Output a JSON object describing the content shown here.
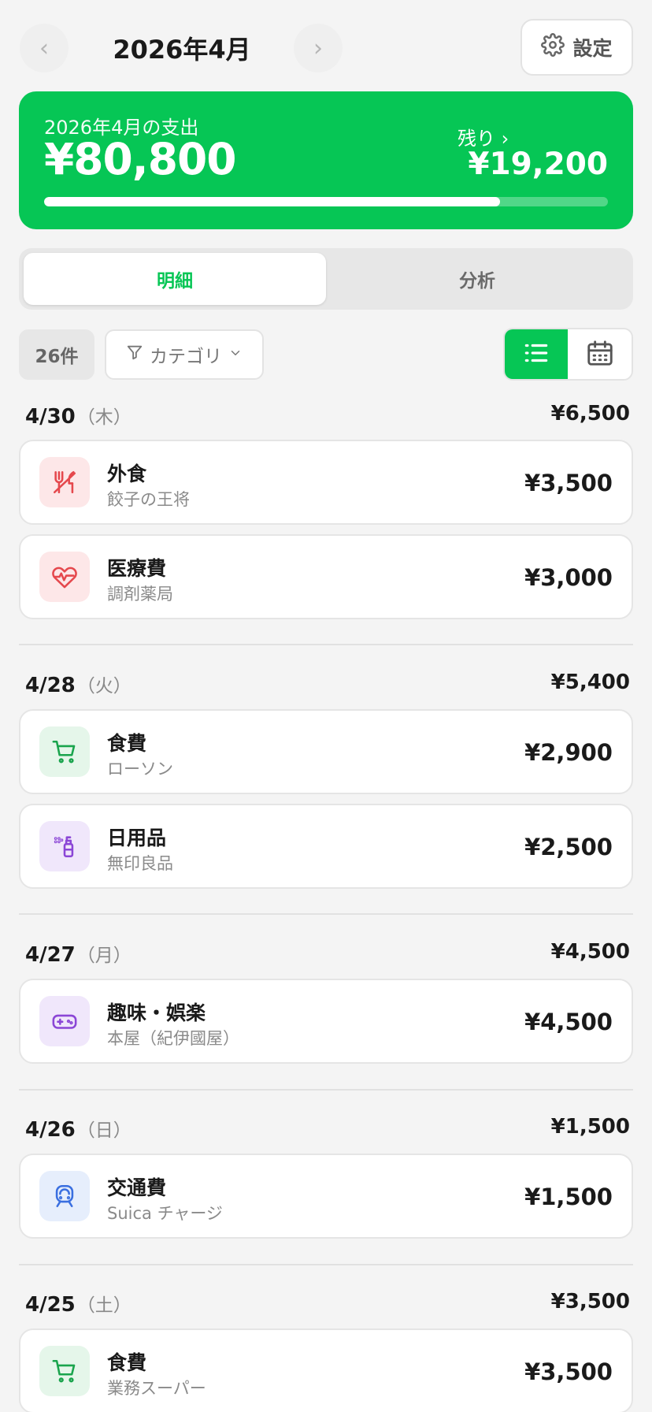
{
  "header": {
    "prev_label": "‹",
    "next_label": "›",
    "month": "2026年4月",
    "settings_label": "設定"
  },
  "summary": {
    "label": "2026年4月の支出",
    "total": "¥80,800",
    "remaining_label": "残り ›",
    "remaining": "¥19,200",
    "progress_ratio": 0.808
  },
  "tabs": [
    {
      "label": "明細",
      "active": true
    },
    {
      "label": "分析",
      "active": false
    }
  ],
  "filters": {
    "count": "26件",
    "category_label": "カテゴリ"
  },
  "colors": {
    "accent": "#06c655",
    "dining_bg": "#fde7e8",
    "dining_fg": "#e5484d",
    "medical_bg": "#fde7e8",
    "medical_fg": "#e5484d",
    "food_bg": "#e5f6ea",
    "food_fg": "#1aa44d",
    "daily_bg": "#f0e7fb",
    "daily_fg": "#8b46d6",
    "hobby_bg": "#f0e7fb",
    "hobby_fg": "#8b46d6",
    "transport_bg": "#e6eefc",
    "transport_fg": "#3a6fe0"
  },
  "days": [
    {
      "date": "4/30",
      "weekday": "（木）",
      "total": "¥6,500",
      "items": [
        {
          "icon": "fork-knife-icon",
          "category": "外食",
          "store": "餃子の王将",
          "amount": "¥3,500"
        },
        {
          "icon": "heart-pulse-icon",
          "category": "医療費",
          "store": "調剤薬局",
          "amount": "¥3,000"
        }
      ]
    },
    {
      "date": "4/28",
      "weekday": "（火）",
      "total": "¥5,400",
      "items": [
        {
          "icon": "cart-icon",
          "category": "食費",
          "store": "ローソン",
          "amount": "¥2,900"
        },
        {
          "icon": "spray-bottle-icon",
          "category": "日用品",
          "store": "無印良品",
          "amount": "¥2,500"
        }
      ]
    },
    {
      "date": "4/27",
      "weekday": "（月）",
      "total": "¥4,500",
      "items": [
        {
          "icon": "gamepad-icon",
          "category": "趣味・娯楽",
          "store": "本屋（紀伊國屋）",
          "amount": "¥4,500"
        }
      ]
    },
    {
      "date": "4/26",
      "weekday": "（日）",
      "total": "¥1,500",
      "items": [
        {
          "icon": "train-icon",
          "category": "交通費",
          "store": "Suica チャージ",
          "amount": "¥1,500"
        }
      ]
    },
    {
      "date": "4/25",
      "weekday": "（土）",
      "total": "¥3,500",
      "items": [
        {
          "icon": "cart-icon",
          "category": "食費",
          "store": "業務スーパー",
          "amount": "¥3,500"
        }
      ]
    }
  ]
}
